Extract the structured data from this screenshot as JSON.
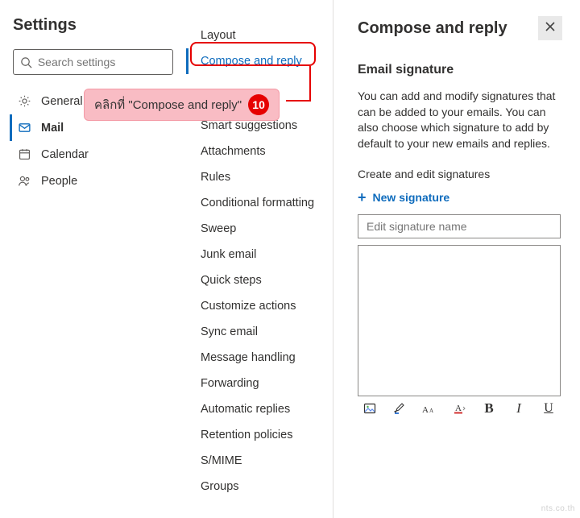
{
  "page_title": "Settings",
  "search": {
    "placeholder": "Search settings"
  },
  "nav": {
    "general": "General",
    "mail": "Mail",
    "calendar": "Calendar",
    "people": "People"
  },
  "mail_menu": {
    "layout": "Layout",
    "compose_reply": "Compose and reply",
    "smart_suggestions": "Smart suggestions",
    "attachments": "Attachments",
    "rules": "Rules",
    "conditional_formatting": "Conditional formatting",
    "sweep": "Sweep",
    "junk_email": "Junk email",
    "quick_steps": "Quick steps",
    "customize_actions": "Customize actions",
    "sync_email": "Sync email",
    "message_handling": "Message handling",
    "forwarding": "Forwarding",
    "automatic_replies": "Automatic replies",
    "retention_policies": "Retention policies",
    "smime": "S/MIME",
    "groups": "Groups"
  },
  "pane": {
    "title": "Compose and reply",
    "section_title": "Email signature",
    "body": "You can add and modify signatures that can be added to your emails. You can also choose which signature to add by default to your new emails and replies.",
    "create_label": "Create and edit signatures",
    "new_signature": "New signature",
    "sig_name_placeholder": "Edit signature name",
    "toolbar": {
      "b": "B",
      "i": "I",
      "u": "U"
    }
  },
  "annotation": {
    "text": "คลิกที่ \"Compose and reply\"",
    "badge": "10"
  },
  "watermark": "nts.co.th"
}
